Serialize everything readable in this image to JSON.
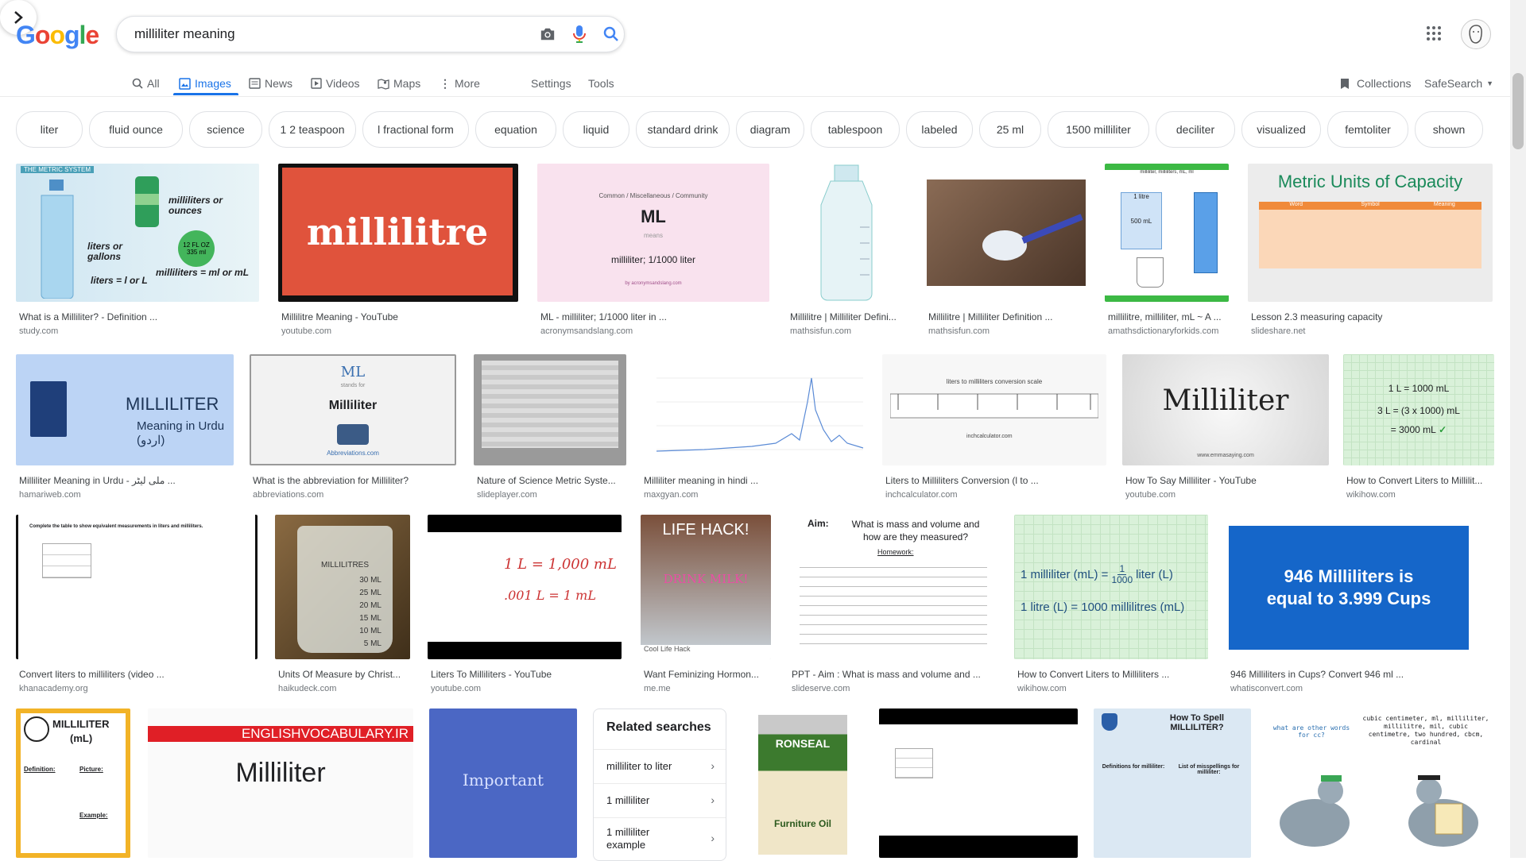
{
  "logo": [
    "G",
    "o",
    "o",
    "g",
    "l",
    "e"
  ],
  "search": {
    "query": "milliliter meaning"
  },
  "tabs": {
    "all": "All",
    "images": "Images",
    "news": "News",
    "videos": "Videos",
    "maps": "Maps",
    "more": "More",
    "settings": "Settings",
    "tools": "Tools"
  },
  "right_links": {
    "collections": "Collections",
    "safesearch": "SafeSearch"
  },
  "chips": [
    "liter",
    "fluid ounce",
    "science",
    "1 2 teaspoon",
    "l fractional form",
    "equation",
    "liquid",
    "standard drink",
    "diagram",
    "tablespoon",
    "labeled",
    "25 ml",
    "1500 milliliter",
    "deciliter",
    "visualized",
    "femtoliter",
    "shown"
  ],
  "results": [
    {
      "title": "What is a Milliliter? - Definition ...",
      "source": "study.com",
      "img": {
        "t1": "THE METRIC SYSTEM",
        "t2": "milliliters or ounces",
        "t3": "liters or gallons",
        "t4": "liters = l or L",
        "t5": "milliliters = ml or mL",
        "t6": "12 FL OZ 335 ml"
      }
    },
    {
      "title": "Millilitre Meaning - YouTube",
      "source": "youtube.com",
      "img": {
        "t1": "millilitre"
      }
    },
    {
      "title": "ML - milliliter; 1/1000 liter in ...",
      "source": "acronymsandslang.com",
      "img": {
        "t1": "Common / Miscellaneous / Community",
        "t2": "ML",
        "t3": "means",
        "t4": "milliliter; 1/1000 liter",
        "t5": "by acronymsandslang.com"
      }
    },
    {
      "title": "Millilitre | Milliliter Defini...",
      "source": "mathsisfun.com",
      "img": {}
    },
    {
      "title": "Millilitre | Milliliter Definition ...",
      "source": "mathsisfun.com",
      "img": {}
    },
    {
      "title": "millilitre, milliliter, mL ~ A ...",
      "source": "amathsdictionaryforkids.com",
      "img": {
        "t1": "milliliter, milliliters, mL, ml",
        "t2": "1 litre",
        "t3": "500 mL"
      }
    },
    {
      "title": "Lesson 2.3 measuring capacity",
      "source": "slideshare.net",
      "img": {
        "t1": "Metric Units of Capacity",
        "h1": "Word",
        "h2": "Symbol",
        "h3": "Meaning"
      }
    },
    {
      "title": "Milliliter Meaning in Urdu - ملی لیٹر ...",
      "source": "hamariweb.com",
      "img": {
        "t1": "MILLILITER",
        "t2": "Meaning in Urdu (اردو)"
      }
    },
    {
      "title": "What is the abbreviation for Milliliter?",
      "source": "abbreviations.com",
      "img": {
        "t1": "ML",
        "t2": "stands for",
        "t3": "Milliliter",
        "t4": "Abbreviations.com"
      }
    },
    {
      "title": "Nature of Science Metric Syste...",
      "source": "slideplayer.com",
      "img": {}
    },
    {
      "title": "Milliliter meaning in hindi ...",
      "source": "maxgyan.com",
      "img": {}
    },
    {
      "title": "Liters to Milliliters Conversion (l to ...",
      "source": "inchcalculator.com",
      "img": {
        "t1": "liters to milliliters conversion scale",
        "t2": "inchcalculator.com"
      }
    },
    {
      "title": "How To Say Milliliter - YouTube",
      "source": "youtube.com",
      "img": {
        "t1": "Milliliter",
        "t2": "www.emmasaying.com"
      }
    },
    {
      "title": "How to Convert Liters to Millilit...",
      "source": "wikihow.com",
      "img": {
        "t1": "1 L = 1000 mL",
        "t2": "3 L = (3 x 1000) mL",
        "t3": "= 3000 mL"
      }
    },
    {
      "title": "Convert liters to milliliters (video ...",
      "source": "khanacademy.org",
      "img": {
        "t1": "Complete the table to show equivalent measurements in liters and milliliters."
      }
    },
    {
      "title": "Units Of Measure by Christ...",
      "source": "haikudeck.com",
      "img": {
        "t1": "MILLILITRES",
        "t2": "30 ML",
        "t3": "25 ML",
        "t4": "20 ML",
        "t5": "15 ML",
        "t6": "10 ML",
        "t7": "5 ML"
      }
    },
    {
      "title": "Liters To Milliliters - YouTube",
      "source": "youtube.com",
      "img": {
        "t1": "1 L = 1,000 mL",
        "t2": ".001 L = 1 mL"
      }
    },
    {
      "title": "Want Feminizing Hormon...",
      "source": "me.me",
      "img": {
        "t1": "LIFE HACK!",
        "t2": "DRINK MILK!",
        "t3": "Cool Life Hack"
      }
    },
    {
      "title": "PPT - Aim : What is mass and volume and ...",
      "source": "slideserve.com",
      "img": {
        "t1": "Aim:",
        "t2": "What is mass and volume and how are they measured?",
        "t3": "Homework:"
      }
    },
    {
      "title": "How to Convert Liters to Milliliters ...",
      "source": "wikihow.com",
      "img": {
        "t1": "1 milliliter (mL) =",
        "t2": "1",
        "t3": "1000",
        "t4": "liter (L)",
        "t5": "1 litre (L) = 1000 millilitres (mL)"
      }
    },
    {
      "title": "946 Milliliters in Cups? Convert 946 ml ...",
      "source": "whatisconvert.com",
      "img": {
        "t1": "946 Milliliters is equal to 3.999 Cups"
      }
    },
    {
      "title": "",
      "source": "",
      "img": {
        "t1": "MILLILITER",
        "t2": "(mL)",
        "t3": "Definition:",
        "t4": "Picture:",
        "t5": "Example:"
      }
    },
    {
      "title": "",
      "source": "",
      "img": {
        "t1": "ENGLISHVOCABULARY.IR",
        "t2": "Milliliter"
      }
    },
    {
      "title": "",
      "source": "",
      "img": {
        "t1": "Important"
      }
    },
    {
      "title": "",
      "source": "",
      "img": {
        "t1": "RONSEAL",
        "t2": "Furniture Oil"
      }
    },
    {
      "title": "",
      "source": "",
      "img": {}
    },
    {
      "title": "",
      "source": "",
      "img": {
        "t1": "How To Spell MILLILITER?",
        "t2": "Definitions for milliliter:",
        "t3": "List of misspellings for milliliter:"
      }
    },
    {
      "title": "",
      "source": "",
      "img": {
        "t1": "cubic centimeter, ml, milliliter, millilitre, mil, cubic centimetre, two hundred, cbcm, cardinal",
        "t2": "what are other words for cc?"
      }
    }
  ],
  "related": {
    "title": "Related searches",
    "items": [
      "milliliter to liter",
      "1 milliliter",
      "1 milliliter example"
    ]
  },
  "colors": {
    "accent": "#1a73e8",
    "google_blue": "#4285f4",
    "google_red": "#ea4335",
    "google_yellow": "#fbbc05",
    "google_green": "#34a853"
  }
}
